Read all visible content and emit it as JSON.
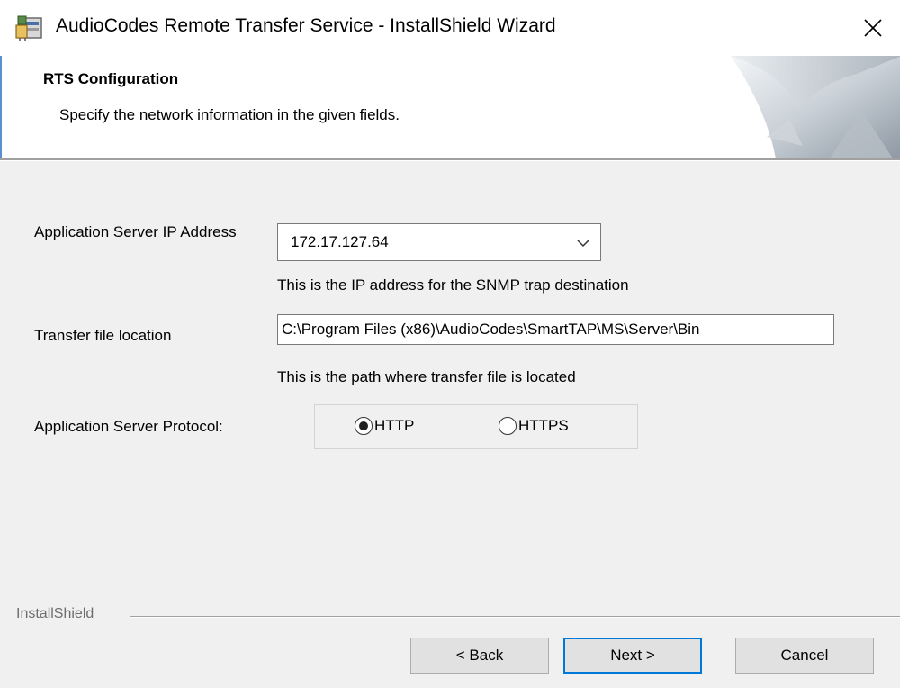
{
  "window": {
    "title": "AudioCodes Remote Transfer Service - InstallShield Wizard",
    "close_glyph": "✕"
  },
  "banner": {
    "title": "RTS Configuration",
    "subtitle": "Specify the network information in the given fields."
  },
  "form": {
    "ip_label": "Application Server IP Address",
    "ip_value": "172.17.127.64",
    "ip_hint": "This is the IP address for the SNMP trap destination",
    "path_label": "Transfer file location",
    "path_value": "C:\\Program Files (x86)\\AudioCodes\\SmartTAP\\MS\\Server\\Bin",
    "path_hint": "This is the path where transfer file is located",
    "protocol_label": "Application Server Protocol:",
    "protocol_options": [
      {
        "label": "HTTP",
        "selected": true
      },
      {
        "label": "HTTPS",
        "selected": false
      }
    ]
  },
  "footer": {
    "brand": "InstallShield",
    "back_label": "< Back",
    "next_label": "Next >",
    "cancel_label": "Cancel"
  },
  "colors": {
    "accent": "#0078d7",
    "banner_border": "#5a8fd0",
    "dialog_bg": "#f0f0f0"
  }
}
